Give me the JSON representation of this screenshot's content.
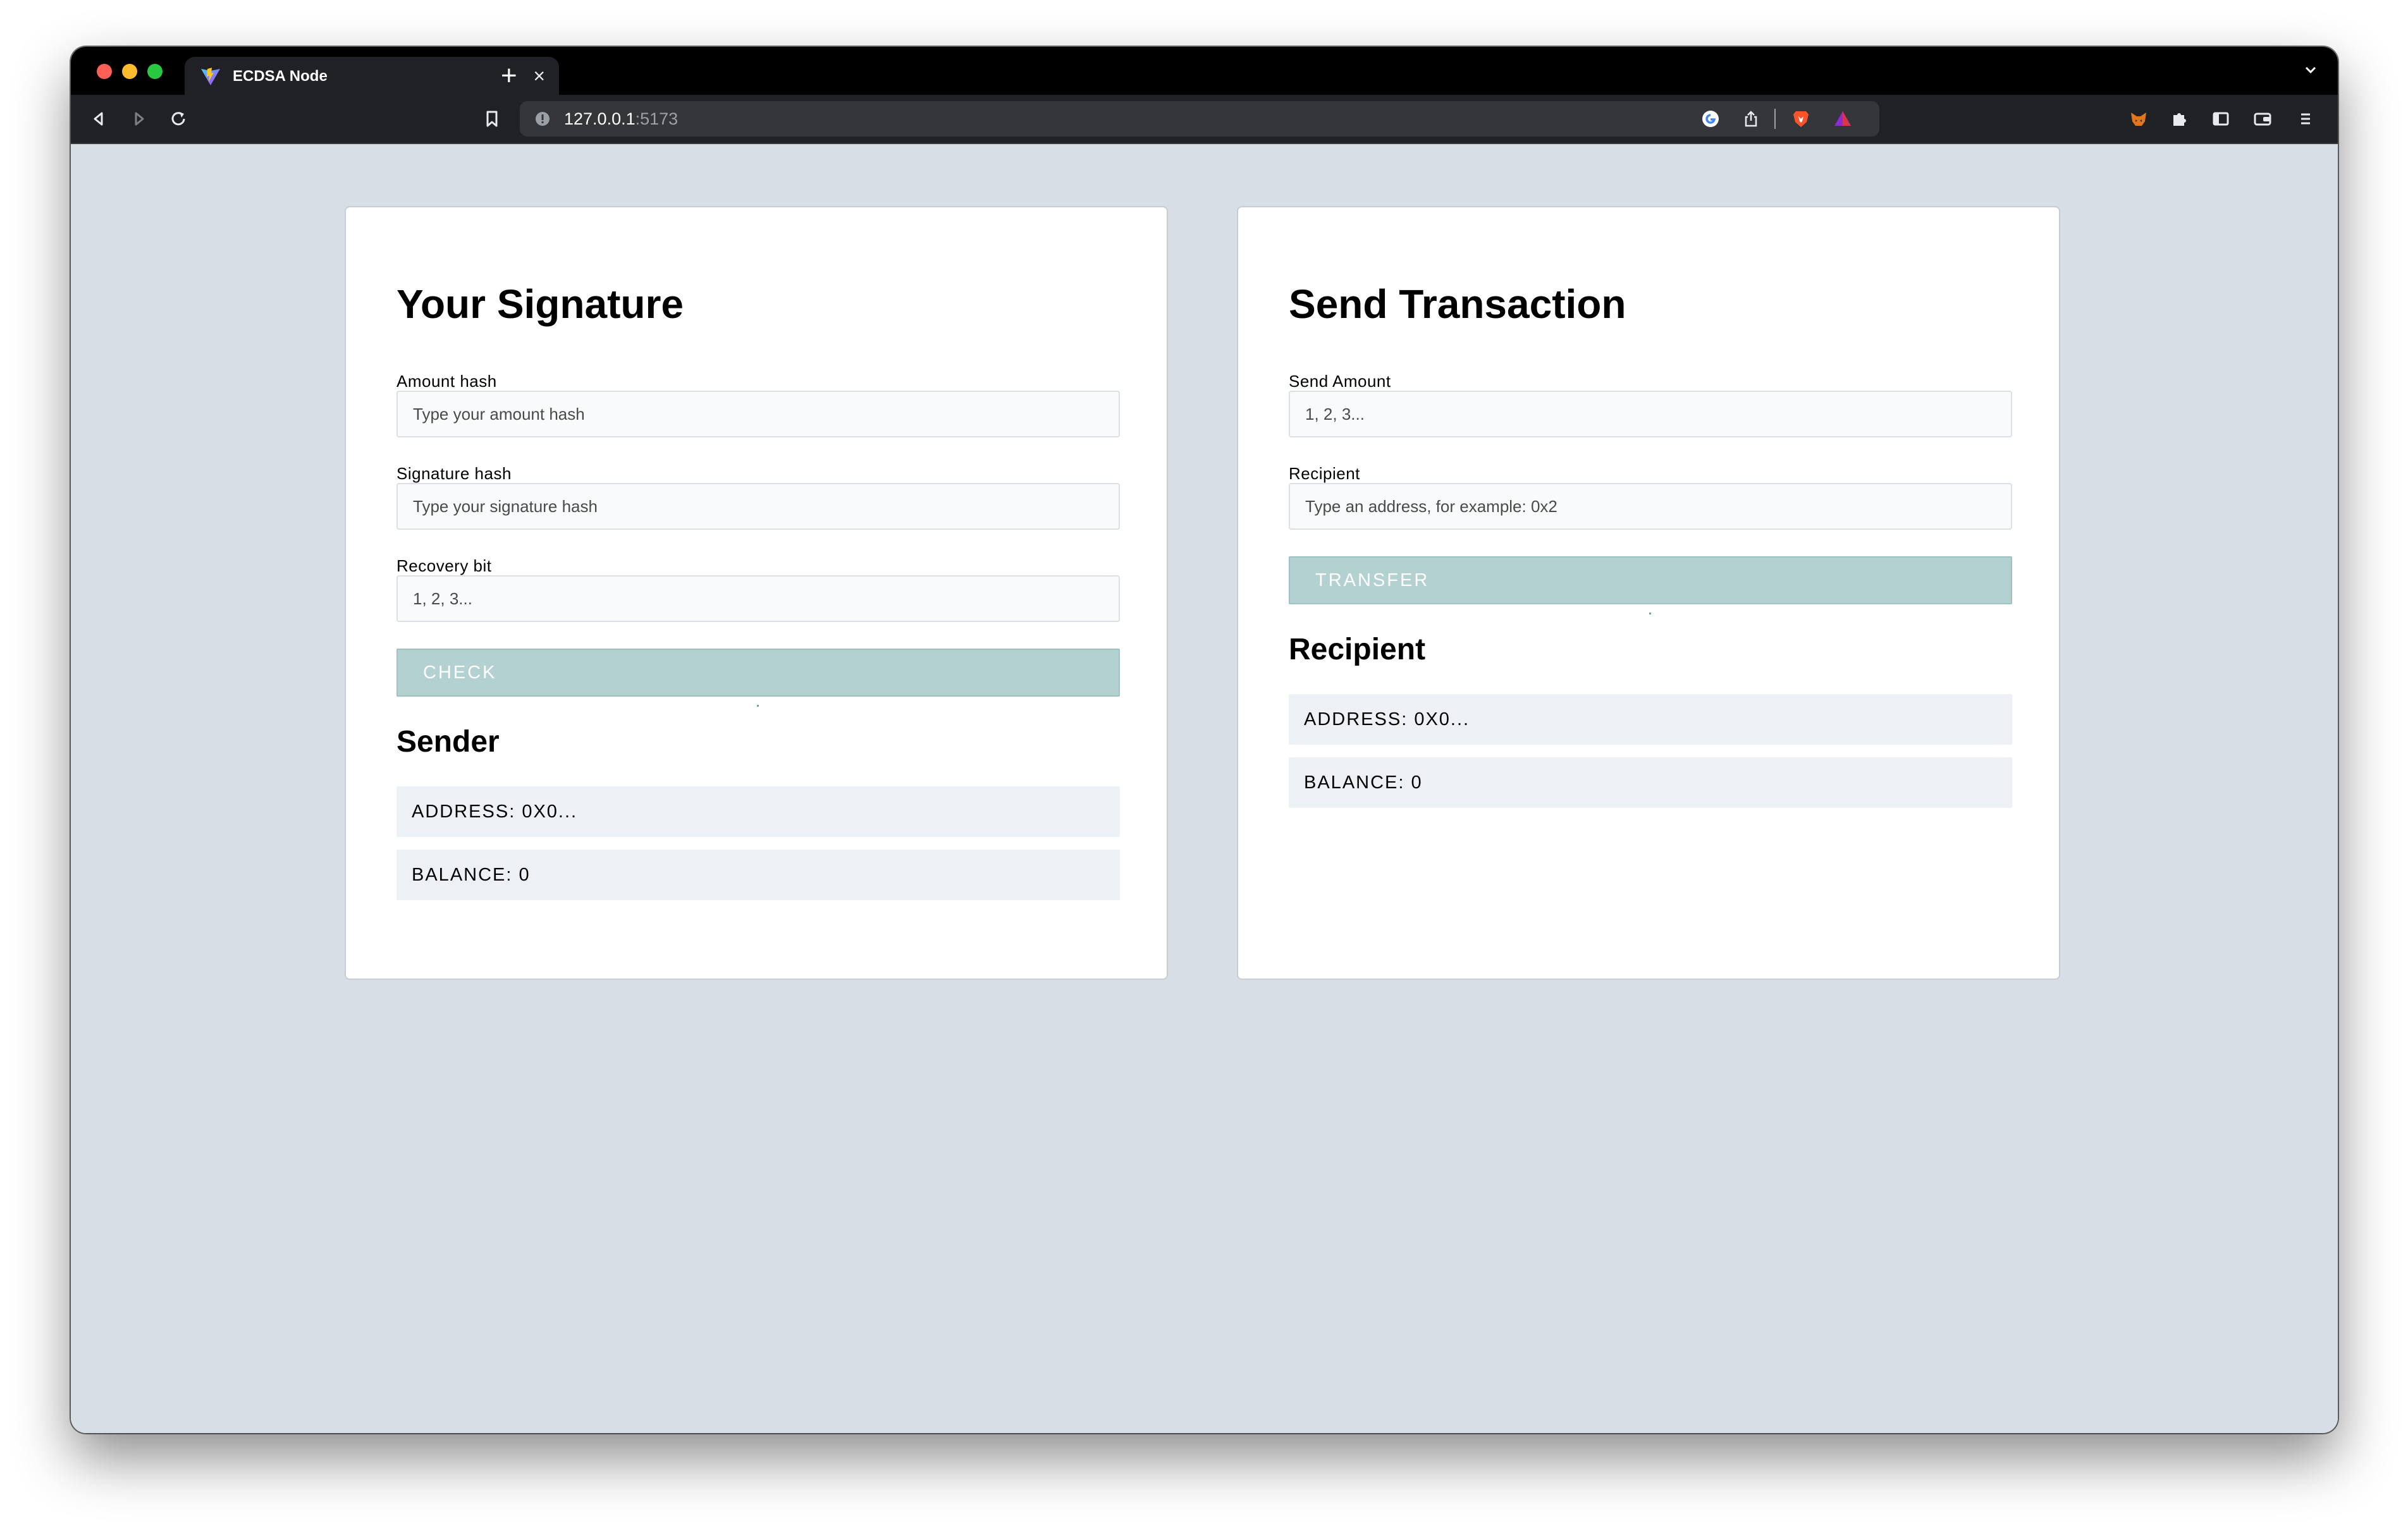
{
  "browser": {
    "tab_title": "ECDSA Node",
    "tab_close": "×",
    "new_tab": "+",
    "url_host": "127.0.0.1",
    "url_port": ":5173"
  },
  "signature_card": {
    "title": "Your Signature",
    "amount_label": "Amount hash",
    "amount_placeholder": "Type your amount hash",
    "signature_label": "Signature hash",
    "signature_placeholder": "Type your signature hash",
    "recovery_label": "Recovery bit",
    "recovery_placeholder": "1, 2, 3...",
    "check_button": "CHECK",
    "sender_heading": "Sender",
    "sender_address": "ADDRESS: 0X0...",
    "sender_balance": "BALANCE: 0"
  },
  "transaction_card": {
    "title": "Send Transaction",
    "amount_label": "Send Amount",
    "amount_placeholder": "1, 2, 3...",
    "recipient_label": "Recipient",
    "recipient_placeholder": "Type an address, for example: 0x2",
    "transfer_button": "TRANSFER",
    "recipient_heading": "Recipient",
    "recipient_address": "ADDRESS: 0X0...",
    "recipient_balance": "BALANCE: 0"
  }
}
